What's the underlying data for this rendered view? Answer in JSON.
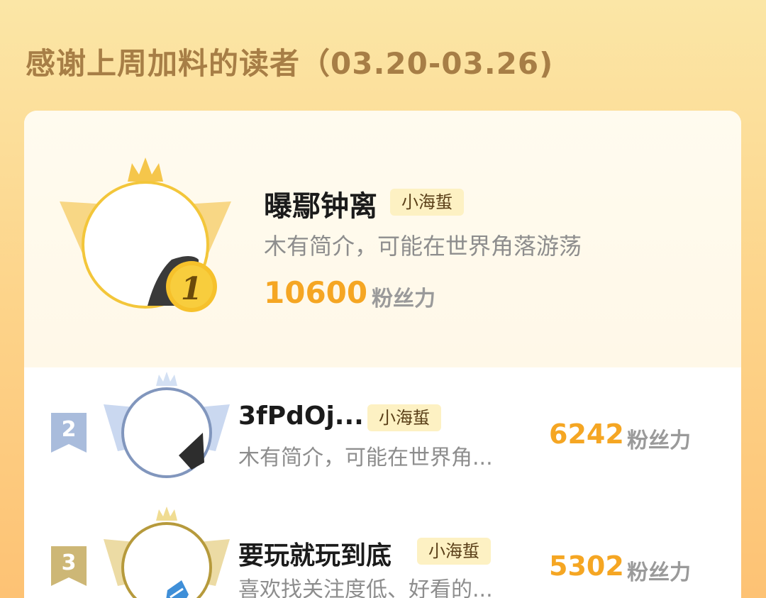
{
  "page": {
    "title": "感谢上周加料的读者（03.20-03.26)"
  },
  "colors": {
    "accent": "#f5a623",
    "title": "#a77e46",
    "gold": "#f3c63a",
    "silver": "#8fa3c4",
    "bronze": "#c9a94a"
  },
  "readers": [
    {
      "rank": "1",
      "name": "曝鄢钟离",
      "badge": "小海蜇",
      "bio": "木有简介，可能在世界角落游荡",
      "fans_value": "10600",
      "fans_label": "粉丝力",
      "frame": "gold"
    },
    {
      "rank": "2",
      "name": "3fPdOj...",
      "badge": "小海蜇",
      "bio": "木有简介，可能在世界角...",
      "fans_value": "6242",
      "fans_label": "粉丝力",
      "frame": "silver"
    },
    {
      "rank": "3",
      "name": "要玩就玩到底",
      "badge": "小海蜇",
      "bio": "喜欢找关注度低、好看的...",
      "fans_value": "5302",
      "fans_label": "粉丝力",
      "frame": "bronze"
    }
  ]
}
